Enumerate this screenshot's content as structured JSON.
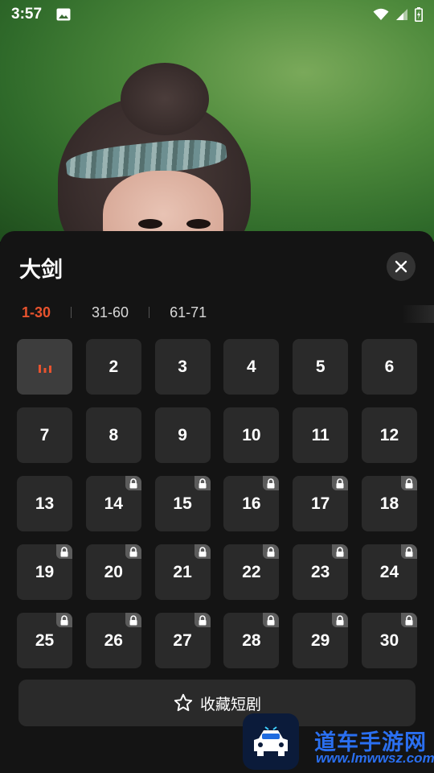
{
  "status_bar": {
    "time": "3:57",
    "icons": [
      "image-notification-icon",
      "wifi-icon",
      "cell-signal-icon",
      "battery-icon"
    ]
  },
  "panel": {
    "title": "大剑",
    "tabs": [
      {
        "label": "1-30",
        "active": true
      },
      {
        "label": "31-60",
        "active": false
      },
      {
        "label": "61-71",
        "active": false
      }
    ],
    "episodes": [
      {
        "label": "",
        "playing": true,
        "locked": false
      },
      {
        "label": "2",
        "locked": false
      },
      {
        "label": "3",
        "locked": false
      },
      {
        "label": "4",
        "locked": false
      },
      {
        "label": "5",
        "locked": false
      },
      {
        "label": "6",
        "locked": false
      },
      {
        "label": "7",
        "locked": false
      },
      {
        "label": "8",
        "locked": false
      },
      {
        "label": "9",
        "locked": false
      },
      {
        "label": "10",
        "locked": false
      },
      {
        "label": "11",
        "locked": false
      },
      {
        "label": "12",
        "locked": false
      },
      {
        "label": "13",
        "locked": false
      },
      {
        "label": "14",
        "locked": true
      },
      {
        "label": "15",
        "locked": true
      },
      {
        "label": "16",
        "locked": true
      },
      {
        "label": "17",
        "locked": true
      },
      {
        "label": "18",
        "locked": true
      },
      {
        "label": "19",
        "locked": true
      },
      {
        "label": "20",
        "locked": true
      },
      {
        "label": "21",
        "locked": true
      },
      {
        "label": "22",
        "locked": true
      },
      {
        "label": "23",
        "locked": true
      },
      {
        "label": "24",
        "locked": true
      },
      {
        "label": "25",
        "locked": true
      },
      {
        "label": "26",
        "locked": true
      },
      {
        "label": "27",
        "locked": true
      },
      {
        "label": "28",
        "locked": true
      },
      {
        "label": "29",
        "locked": true
      },
      {
        "label": "30",
        "locked": true
      }
    ],
    "favorite_label": "收藏短剧"
  },
  "watermark": {
    "title": "道车手游网",
    "url": "www.lmwwsz.com"
  },
  "colors": {
    "accent": "#e8532e",
    "panel_bg": "#141414",
    "tile_bg": "#2a2a2a",
    "watermark_blue": "#2a6ff0"
  }
}
